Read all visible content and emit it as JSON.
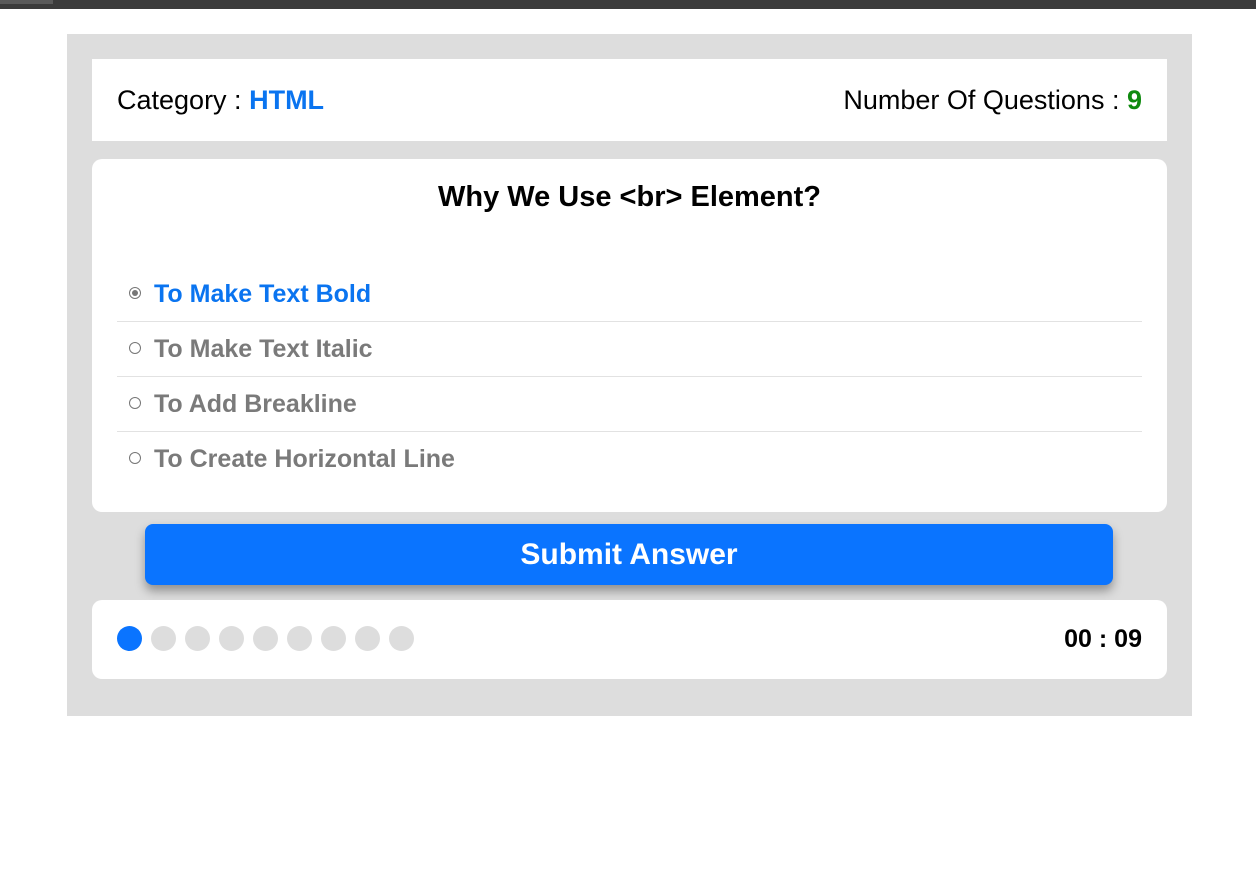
{
  "colors": {
    "accent": "#0a74ff",
    "category": "#0a74f0",
    "count": "#0f8a0f",
    "unselected_answer": "#7a7a7a",
    "panel_bg": "#dddddd",
    "bullet_inactive": "#dddddd"
  },
  "info": {
    "category_label": "Category :",
    "category_value": "HTML",
    "count_label": "Number Of Questions :",
    "count_value": "9"
  },
  "question": {
    "title": "Why We Use <br> Element?",
    "answers": [
      {
        "label": "To Make Text Bold",
        "selected": true
      },
      {
        "label": "To Make Text Italic",
        "selected": false
      },
      {
        "label": "To Add Breakline",
        "selected": false
      },
      {
        "label": "To Create Horizontal Line",
        "selected": false
      }
    ]
  },
  "submit": {
    "label": "Submit Answer"
  },
  "progress": {
    "total": 9,
    "current": 1
  },
  "countdown": {
    "text": "00 : 09"
  }
}
